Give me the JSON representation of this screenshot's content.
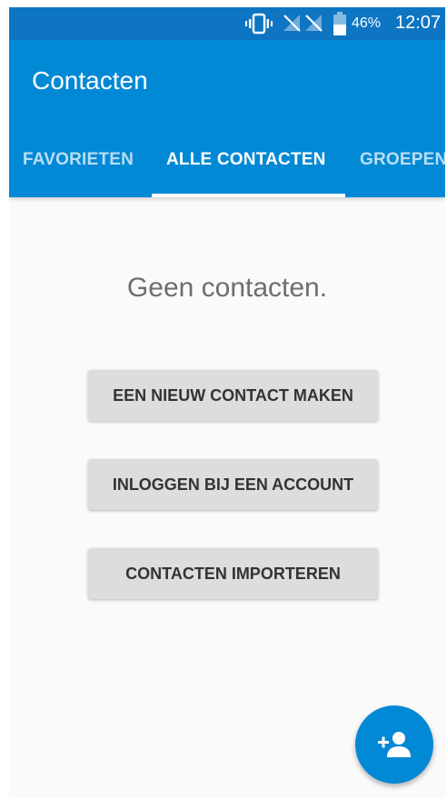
{
  "status_bar": {
    "battery_text": "46%",
    "time": "12:07",
    "icons": [
      "vibrate-icon",
      "no-signal-icon",
      "no-signal-icon",
      "battery-icon"
    ]
  },
  "app_bar": {
    "title": "Contacten",
    "tabs": [
      {
        "label": "FAVORIETEN",
        "selected": false
      },
      {
        "label": "ALLE CONTACTEN",
        "selected": true
      },
      {
        "label": "GROEPEN",
        "selected": false
      }
    ]
  },
  "content": {
    "empty_message": "Geen contacten.",
    "buttons": [
      {
        "label": "EEN NIEUW CONTACT MAKEN"
      },
      {
        "label": "INLOGGEN BIJ EEN ACCOUNT"
      },
      {
        "label": "CONTACTEN IMPORTEREN"
      }
    ]
  },
  "fab": {
    "icon": "add-person-icon"
  },
  "colors": {
    "status_bar": "#0e75c3",
    "app_bar": "#0289d6",
    "accent": "#0289d6",
    "background": "#fafafa",
    "button": "#dddddd"
  }
}
